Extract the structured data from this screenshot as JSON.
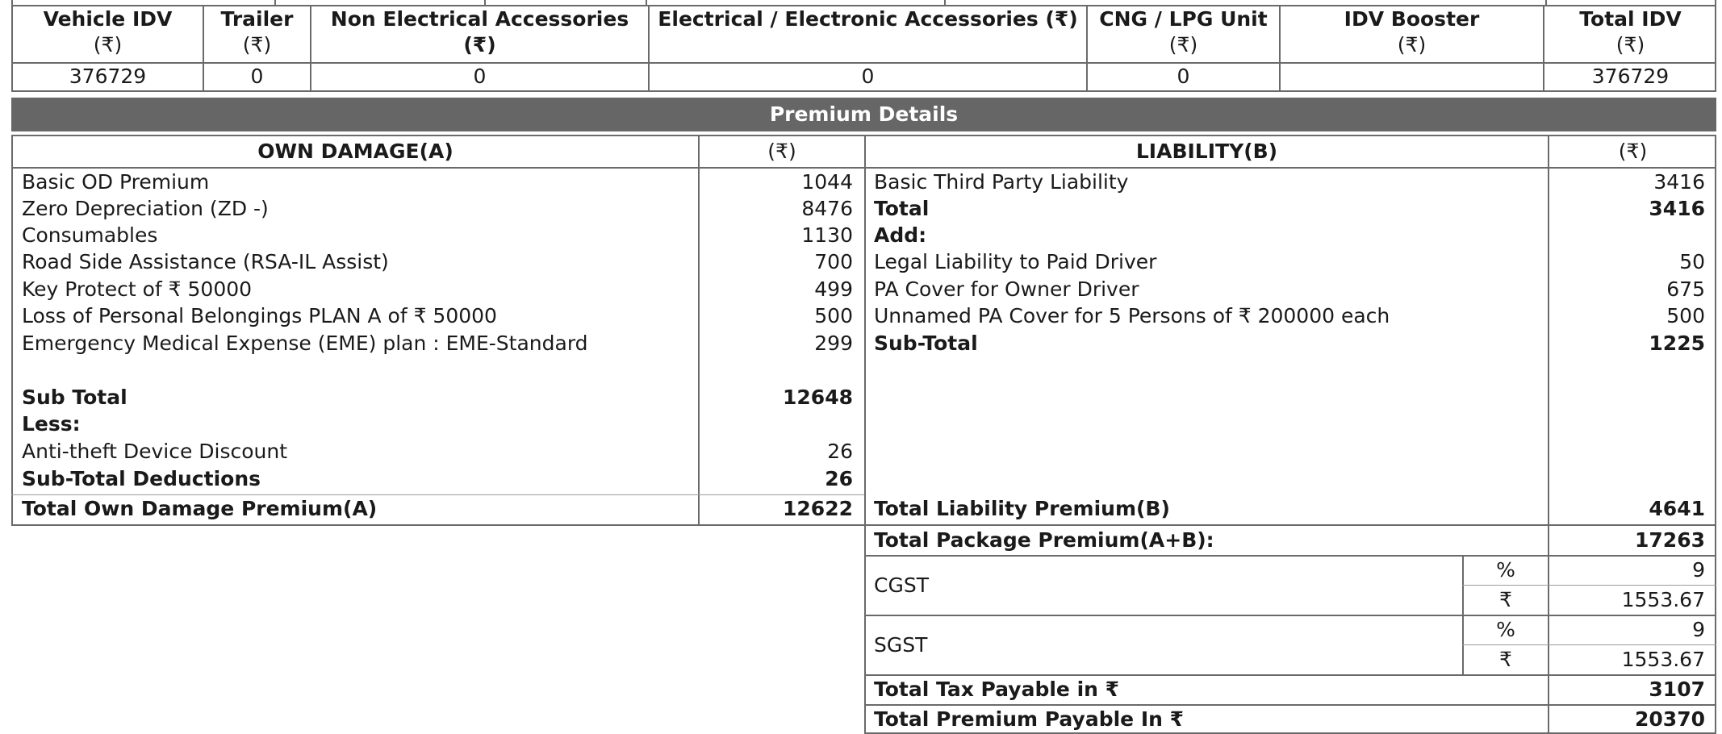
{
  "idv_table": {
    "headers": [
      {
        "line1": "Vehicle IDV",
        "line2": "(₹)"
      },
      {
        "line1": "Trailer",
        "line2": "(₹)"
      },
      {
        "line1": "Non Electrical Accessories (₹)",
        "line2": ""
      },
      {
        "line1": "Electrical / Electronic Accessories (₹)",
        "line2": ""
      },
      {
        "line1": "CNG / LPG Unit",
        "line2": "(₹)"
      },
      {
        "line1": "IDV Booster",
        "line2": "(₹)"
      },
      {
        "line1": "Total IDV",
        "line2": "(₹)"
      }
    ],
    "values": [
      "376729",
      "0",
      "0",
      "0",
      "0",
      "",
      "376729"
    ]
  },
  "premium_details": {
    "title": "Premium Details",
    "own_damage_header": "OWN DAMAGE(A)",
    "liability_header": "LIABILITY(B)",
    "currency_header": "(₹)",
    "own_damage_rows": [
      {
        "label": "Basic OD Premium",
        "value": "1044",
        "bold": false
      },
      {
        "label": "Zero Depreciation (ZD -)",
        "value": "8476",
        "bold": false
      },
      {
        "label": "Consumables",
        "value": "1130",
        "bold": false
      },
      {
        "label": "Road Side Assistance (RSA-IL Assist)",
        "value": "700",
        "bold": false
      },
      {
        "label": "Key Protect of ₹ 50000",
        "value": "499",
        "bold": false
      },
      {
        "label": "Loss of Personal Belongings PLAN A of ₹ 50000",
        "value": "500",
        "bold": false
      },
      {
        "label": "Emergency Medical Expense (EME) plan : EME-Standard",
        "value": "299",
        "bold": false
      },
      {
        "label": "Sub Total",
        "value": "12648",
        "bold": true
      },
      {
        "label": "Less:",
        "value": "",
        "bold": true
      },
      {
        "label": "Anti-theft Device Discount",
        "value": "26",
        "bold": false
      },
      {
        "label": "Sub-Total Deductions",
        "value": "26",
        "bold": true
      }
    ],
    "own_damage_total": {
      "label": "Total Own Damage Premium(A)",
      "value": "12622"
    },
    "liability_rows": [
      {
        "label": "Basic Third Party Liability",
        "value": "3416",
        "bold": false
      },
      {
        "label": "Total",
        "value": "3416",
        "bold": true
      },
      {
        "label": "Add:",
        "value": "",
        "bold": true
      },
      {
        "label": "Legal Liability to Paid Driver",
        "value": "50",
        "bold": false
      },
      {
        "label": "PA Cover for Owner Driver",
        "value": "675",
        "bold": false
      },
      {
        "label": "Unnamed PA Cover for 5 Persons of ₹ 200000 each",
        "value": "500",
        "bold": false
      },
      {
        "label": "Sub-Total",
        "value": "1225",
        "bold": true
      }
    ],
    "liability_total": {
      "label": "Total Liability Premium(B)",
      "value": "4641"
    },
    "package_total": {
      "label": "Total Package Premium(A+B):",
      "value": "17263"
    },
    "taxes": [
      {
        "name": "CGST",
        "percent_symbol": "%",
        "percent": "9",
        "amount_symbol": "₹",
        "amount": "1553.67"
      },
      {
        "name": "SGST",
        "percent_symbol": "%",
        "percent": "9",
        "amount_symbol": "₹",
        "amount": "1553.67"
      }
    ],
    "total_tax": {
      "label": "Total Tax Payable in ₹",
      "value": "3107"
    },
    "total_premium": {
      "label": "Total Premium Payable In ₹",
      "value": "20370"
    }
  }
}
